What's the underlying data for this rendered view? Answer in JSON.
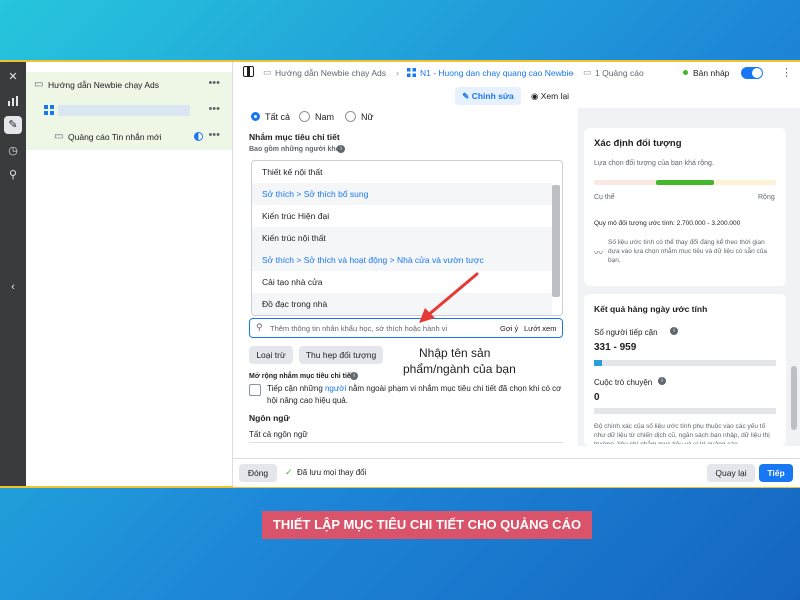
{
  "tree": {
    "campaign": "Hướng dẫn Newbie chạy Ads",
    "ad": "Quảng cáo Tin nhắn mới",
    "dots": "•••"
  },
  "toolbar": {
    "crumb1": "Hướng dẫn Newbie chạy Ads",
    "crumb2": "N1 - Huong dan chay quang cao Newbie",
    "crumb3": "1 Quảng cáo",
    "status": "Bản nháp"
  },
  "subbar": {
    "edit": "Chỉnh sửa",
    "view": "Xem lại"
  },
  "form": {
    "gender": [
      "Tất cả",
      "Nam",
      "Nữ"
    ],
    "targeting_title": "Nhắm mục tiêu chi tiết",
    "includes_label": "Bao gồm những người khớp",
    "items": [
      {
        "text": "Thiết kế nội thất",
        "kind": "item"
      },
      {
        "text": "Sở thích > Sở thích bổ sung",
        "kind": "cat"
      },
      {
        "text": "Kiến trúc Hiện đại",
        "kind": "item"
      },
      {
        "text": "Kiến trúc nội thất",
        "kind": "item"
      },
      {
        "text": "Sở thích > Sở thích và hoạt động > Nhà cửa và vườn tược",
        "kind": "cat"
      },
      {
        "text": "Cải tạo nhà cửa",
        "kind": "item"
      },
      {
        "text": "Đồ đạc trong nhà",
        "kind": "item"
      }
    ],
    "search_placeholder": "Thêm thông tin nhân khẩu học, sở thích hoặc hành vi",
    "suggest": "Gợi ý",
    "browse": "Lướt xem",
    "exclude_btn": "Loại trừ",
    "narrow_btn": "Thu hẹp đối tượng",
    "expand_title": "Mở rộng nhắm mục tiêu chi tiết",
    "expand_text_1": "Tiếp cận những ",
    "expand_link": "người",
    "expand_text_2": " nằm ngoài phạm vi nhắm mục tiêu chi tiết đã chọn khi có cơ",
    "expand_text_3": "hội nâng cao hiệu quả.",
    "language_title": "Ngôn ngữ",
    "language_value": "Tất cả ngôn ngữ"
  },
  "annotation": {
    "line1": "Nhập tên sản",
    "line2": "phẩm/ngành của bạn",
    "color": "#e53935"
  },
  "audience": {
    "title": "Xác định đối tượng",
    "subtitle": "Lựa chọn đối tượng của bạn khá rộng.",
    "specific": "Cụ thể",
    "broad": "Rộng",
    "size_text": "Quy mô đối tượng ước tính: 2.700.000 - 3.200.000",
    "note": "Số liệu ước tính có thể thay đổi đáng kể theo thời gian dựa vào lựa chọn nhắm mục tiêu và dữ liệu có sẵn của bạn."
  },
  "daily": {
    "title": "Kết quả hàng ngày ước tính",
    "reach_label": "Số người tiếp cận",
    "reach_value": "331 - 959",
    "conv_label": "Cuộc trò chuyện",
    "conv_value": "0",
    "note": "Độ chính xác của số liệu ước tính phụ thuộc vào các yếu tố như dữ liệu từ chiến dịch cũ, ngân sách bạn nhập, dữ liệu thị trường, tiêu chí nhắm mục tiêu và vị trí quảng cáo."
  },
  "footer": {
    "close": "Đóng",
    "saved": "Đã lưu mọi thay đổi",
    "back": "Quay lại",
    "next": "Tiếp"
  },
  "caption": "THIẾT LẬP MỤC TIÊU CHI TIẾT CHO QUẢNG CÁO",
  "colors": {
    "accent": "#1877f2",
    "frame": "#f2c12e",
    "caption_bg": "#d9536a",
    "meter_green": "#42b72a"
  }
}
